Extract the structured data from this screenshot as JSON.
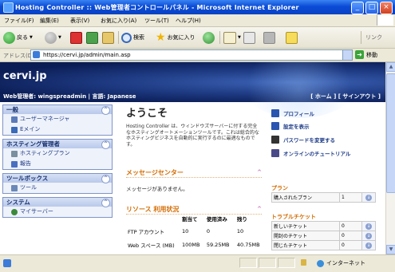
{
  "window": {
    "title": "Hosting Controller :: Web管理者コントロールパネル - Microsoft Internet Explorer",
    "buttons": {
      "minimize": "_",
      "maximize": "□",
      "close": "×"
    }
  },
  "menu": [
    "ファイル(F)",
    "編集(E)",
    "表示(V)",
    "お気に入り(A)",
    "ツール(T)",
    "ヘルプ(H)"
  ],
  "toolbar": {
    "back": "戻る",
    "search": "検索",
    "favorites": "お気に入り",
    "links": "リンク"
  },
  "address": {
    "label": "アドレス(D)",
    "url": "https://cervi.jp/admin/main.asp",
    "go": "移動"
  },
  "page": {
    "brand": "cervi.jp",
    "user_line": "Web管理者: wingspreadmin | 言語: Japanese",
    "top_links": "[ ホーム ] [ サインアウト ]",
    "nav": [
      {
        "title": "一般",
        "toggle": "^",
        "items": [
          {
            "label": "ユーザーマネージャ",
            "icon": "users-icon",
            "color": "#5b7ab8"
          },
          {
            "label": "Eメイン",
            "icon": "email-icon",
            "color": "#3a6ab8"
          }
        ]
      },
      {
        "title": "ホスティング管理者",
        "toggle": "^",
        "items": [
          {
            "label": "ホスティングプラン",
            "icon": "plan-icon",
            "color": "#7a8fa0"
          },
          {
            "label": "報告",
            "icon": "report-icon",
            "color": "#4a70c0"
          }
        ]
      },
      {
        "title": "ツールボックス",
        "toggle": "^",
        "items": [
          {
            "label": "ツール",
            "icon": "tools-icon",
            "color": "#6b88b8"
          }
        ]
      },
      {
        "title": "システム",
        "toggle": "^",
        "items": [
          {
            "label": "マイサーバー",
            "icon": "server-icon",
            "color": "#3b8a3b"
          }
        ]
      }
    ],
    "welcome": "ようこそ",
    "intro": "Hosting Controller は、ウィンドウズサーバーに付する完全なホスティングオートメーションツールです。これは総合的なホスティングビジネスを自動的に実行するのに最適なものです。",
    "message_center": {
      "title": "メッセージセンター",
      "toggle": "^",
      "empty": "メッセージがありません。"
    },
    "resources": {
      "title": "リソース 利用状況",
      "toggle": "^",
      "headers": [
        "",
        "割当て",
        "使用済み",
        "残り"
      ],
      "rows": [
        [
          "FTP アカウント",
          "10",
          "0",
          "10"
        ],
        [
          "Web スペース (MB)",
          "100MB",
          "59.25MB",
          "40.75MB"
        ]
      ]
    },
    "quick_links": [
      {
        "label": "プロフィール",
        "icon": "profile-icon",
        "color": "#2a55b0"
      },
      {
        "label": "設定を表示",
        "icon": "settings-icon",
        "color": "#2a55b0"
      },
      {
        "label": "パスワードを変更する",
        "icon": "key-icon",
        "color": "#333333"
      },
      {
        "label": "オンラインのチュートリアル",
        "icon": "tutorial-icon",
        "color": "#4a4a8a"
      }
    ],
    "plan": {
      "title": "プラン",
      "rows": [
        [
          "購入されたプラン",
          "1"
        ]
      ]
    },
    "tickets": {
      "title": "トラブルチケット",
      "rows": [
        [
          "新しいチケット",
          "0"
        ],
        [
          "開封のチケット",
          "0"
        ],
        [
          "閉じたチケット",
          "0"
        ]
      ]
    }
  },
  "status": {
    "zone": "インターネット"
  }
}
